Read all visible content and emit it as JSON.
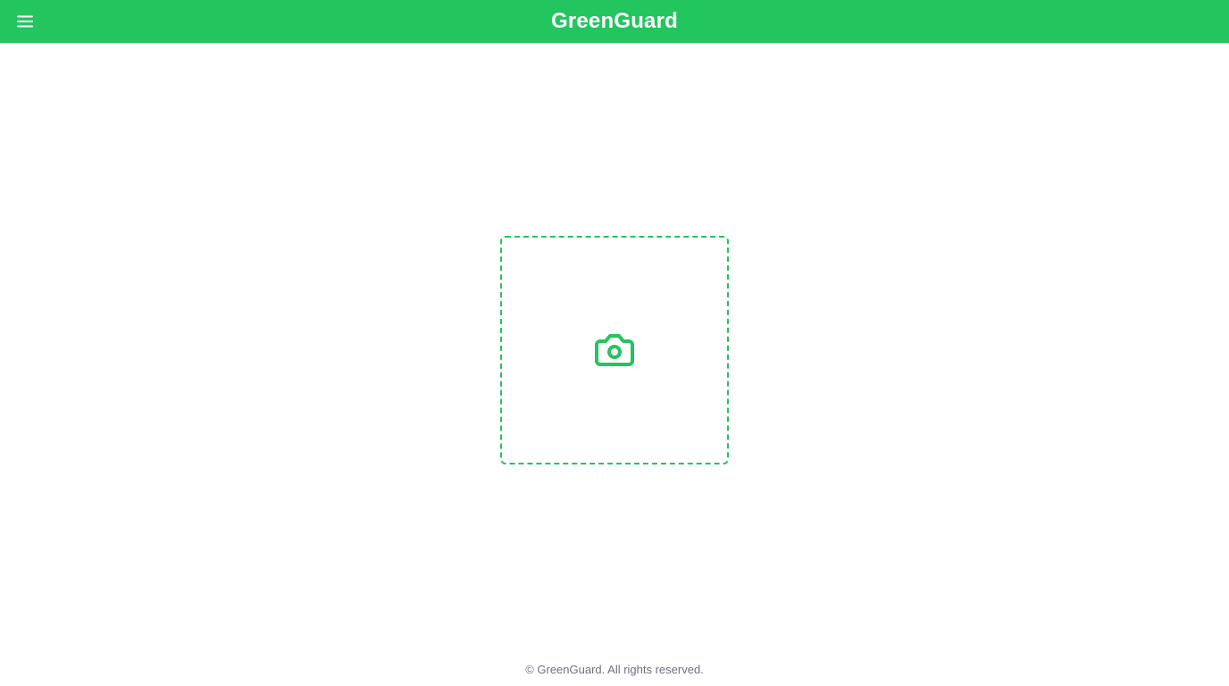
{
  "header": {
    "title": "GreenGuard",
    "menu_icon": "hamburger-menu-icon",
    "background_color": "#22c55e",
    "title_color": "#ffffff"
  },
  "upload": {
    "icon": "camera-icon",
    "border_color": "#22c55e",
    "icon_color": "#22c55e"
  },
  "footer": {
    "text": "© GreenGuard. All rights reserved.",
    "color": "#6b7280"
  }
}
